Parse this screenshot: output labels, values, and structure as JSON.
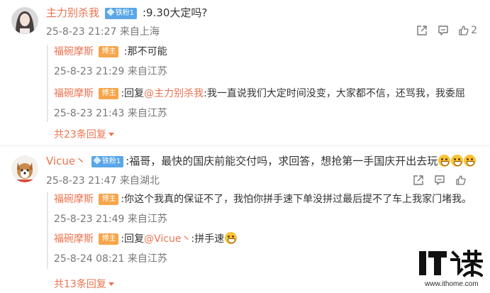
{
  "comments": [
    {
      "user": "主力别杀我",
      "fan_badge": "铁粉1",
      "text": ":9.30大定吗?",
      "time": "25-8-23 21:27",
      "location": "来自上海",
      "like_count": "2",
      "replies": [
        {
          "user": "福碗摩斯",
          "badge": "博主",
          "prefix": "",
          "mention": "",
          "text": ":那不可能",
          "time": "25-8-23 21:29",
          "location": "来自江苏"
        },
        {
          "user": "福碗摩斯",
          "badge": "博主",
          "prefix": ":回复",
          "mention": "@主力别杀我",
          "text": ":我一直说我们大定时间没变，大家都不信，还骂我，我委屈",
          "time": "25-8-23 21:43",
          "location": "来自江苏"
        }
      ],
      "more_replies": "共23条回复"
    },
    {
      "user": "Vicue丶",
      "fan_badge": "铁粉1",
      "text": ":福哥，最快的国庆前能交付吗，求回答，想抢第一手国庆开出去玩",
      "time": "25-8-23 21:47",
      "location": "来自湖北",
      "replies": [
        {
          "user": "福碗摩斯",
          "badge": "博主",
          "prefix": "",
          "mention": "",
          "text": ":你这个我真的保证不了，我怕你拼手速下单没拼过最后提不了车上我家门堵我。",
          "time": "25-8-23 21:49",
          "location": "来自江苏"
        },
        {
          "user": "福碗摩斯",
          "badge": "博主",
          "prefix": ":回复",
          "mention": "@Vicue丶",
          "text": ":拼手速",
          "time": "25-8-24 08:21",
          "location": "来自江苏"
        }
      ],
      "more_replies": "共13条回复"
    }
  ],
  "icons": {
    "share": "share-icon",
    "comment": "comment-icon",
    "like": "thumbs-up-icon",
    "emoji": "grimace-emoji-icon"
  },
  "watermark": {
    "logo": "IT之家",
    "url": "www.ithome.com"
  },
  "colors": {
    "username": "#eb7350",
    "fan_badge": "#5aa6e8",
    "host_badge": "#f7a54a",
    "meta": "#777777",
    "text": "#333333"
  }
}
